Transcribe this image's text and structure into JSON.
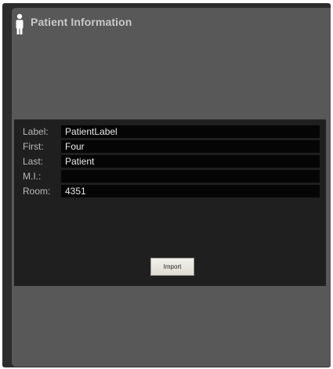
{
  "header": {
    "icon": "person-icon",
    "title": "Patient Information"
  },
  "form": {
    "fields": [
      {
        "label": "Label:",
        "value": "PatientLabel"
      },
      {
        "label": "First:",
        "value": "Four"
      },
      {
        "label": "Last:",
        "value": "Patient"
      },
      {
        "label": "M.I.:",
        "value": ""
      },
      {
        "label": "Room:",
        "value": "4351"
      }
    ],
    "import_label": "Import"
  }
}
